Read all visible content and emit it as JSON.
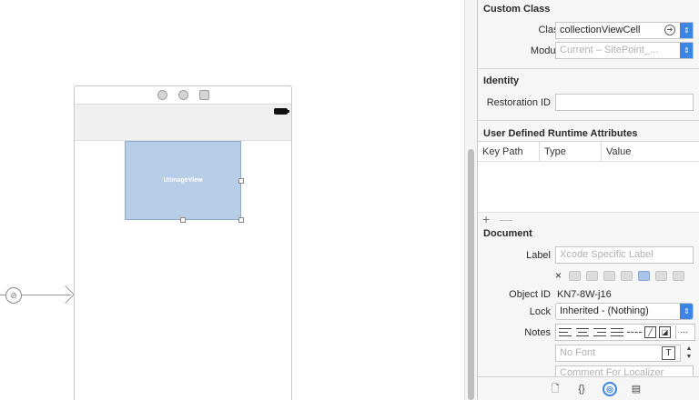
{
  "canvas": {
    "image_view_label": "UIImageView"
  },
  "inspector": {
    "custom_class": {
      "header": "Custom Class",
      "class_label": "Class",
      "class_value": "collectionViewCell",
      "module_label": "Module",
      "module_placeholder": "Current – SitePoint_..."
    },
    "identity": {
      "header": "Identity",
      "restoration_id_label": "Restoration ID",
      "restoration_id_value": ""
    },
    "runtime_attributes": {
      "header": "User Defined Runtime Attributes",
      "columns": [
        "Key Path",
        "Type",
        "Value"
      ],
      "add_label": "+",
      "remove_label": "—"
    },
    "document": {
      "header": "Document",
      "label_label": "Label",
      "label_placeholder": "Xcode Specific Label",
      "clear_label": "×",
      "object_id_label": "Object ID",
      "object_id_value": "KN7-8W-j16",
      "lock_label": "Lock",
      "lock_value": "Inherited - (Nothing)",
      "notes_label": "Notes",
      "more_label": "...",
      "font_placeholder": "No Font",
      "comment_placeholder": "Comment For Localizer"
    }
  },
  "tabbar": {
    "tabs": [
      "file-inspector",
      "quick-help",
      "identity-inspector",
      "attributes-inspector"
    ],
    "active": "identity-inspector"
  },
  "colors": {
    "accent": "#3b86e4",
    "image_view_fill": "#b7cce6"
  }
}
